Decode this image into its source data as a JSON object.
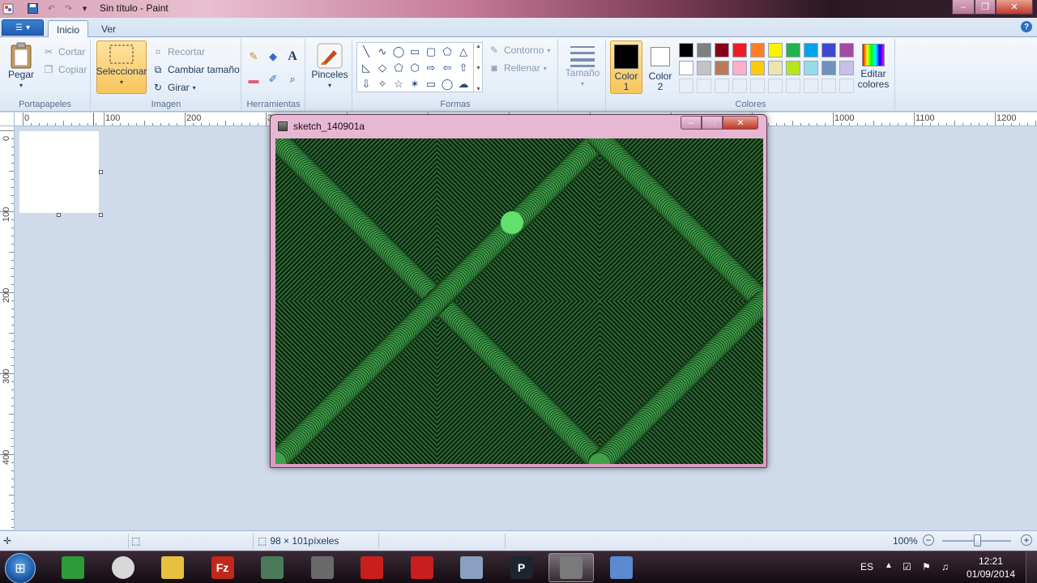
{
  "window": {
    "title": "Sin título - Paint"
  },
  "tabs": [
    {
      "label": "Inicio"
    },
    {
      "label": "Ver"
    }
  ],
  "ribbon": {
    "portapapeles": {
      "label": "Portapapeles",
      "pegar": "Pegar",
      "cortar": "Cortar",
      "copiar": "Copiar"
    },
    "imagen": {
      "label": "Imagen",
      "seleccionar": "Seleccionar",
      "recortar": "Recortar",
      "cambiar_tamano": "Cambiar tamaño",
      "girar": "Girar"
    },
    "herramientas": {
      "label": "Herramientas"
    },
    "pinceles": {
      "label": "Pinceles"
    },
    "formas": {
      "label": "Formas",
      "contorno": "Contorno",
      "rellenar": "Rellenar"
    },
    "tamano": {
      "label": "Tamaño"
    },
    "colores": {
      "label": "Colores",
      "color1_line1": "Color",
      "color1_line2": "1",
      "color2_line1": "Color",
      "color2_line2": "2",
      "editar_line1": "Editar",
      "editar_line2": "colores",
      "color1": "#000000",
      "color2": "#ffffff",
      "palette_row1": [
        "#000000",
        "#7f7f7f",
        "#880015",
        "#ed1c24",
        "#ff7f27",
        "#fff200",
        "#22b14c",
        "#00a2e8",
        "#3f48cc",
        "#a349a4"
      ],
      "palette_row2": [
        "#ffffff",
        "#c3c3c3",
        "#b97a57",
        "#ffaec9",
        "#ffc90e",
        "#efe4b0",
        "#b5e61d",
        "#99d9ea",
        "#7092be",
        "#c8bfe7"
      ]
    }
  },
  "rulers": {
    "h_labels": [
      "0",
      "100",
      "200",
      "300",
      "",
      "",
      "",
      "",
      "",
      "",
      "1000",
      "1100",
      "1200"
    ],
    "v_labels": [
      "0",
      "100",
      "200",
      "300",
      "400"
    ]
  },
  "sketch": {
    "title": "sketch_140901a",
    "fill_color": "#0d1f0f",
    "line_color": "#3fa04a",
    "ball_color": "#62e06e"
  },
  "statusbar": {
    "size": "98 × 101píxeles",
    "zoom": "100%"
  },
  "taskbar": {
    "apps": [
      {
        "icon": "dreamweaver-icon",
        "label": ""
      },
      {
        "icon": "chrome-icon",
        "label": ""
      },
      {
        "icon": "explorer-icon",
        "label": ""
      },
      {
        "icon": "filezilla-icon",
        "label": "Fz"
      },
      {
        "icon": "monitor-icon",
        "label": ""
      },
      {
        "icon": "media-icon",
        "label": ""
      },
      {
        "icon": "autocad-icon",
        "label": ""
      },
      {
        "icon": "autocad-icon-2",
        "label": ""
      },
      {
        "icon": "calculator-icon",
        "label": ""
      },
      {
        "icon": "processing-icon",
        "label": "P"
      },
      {
        "icon": "sketch-app-icon",
        "label": ""
      },
      {
        "icon": "paint-icon",
        "label": ""
      }
    ],
    "language": "ES",
    "time": "12:21",
    "date": "01/09/2014"
  }
}
